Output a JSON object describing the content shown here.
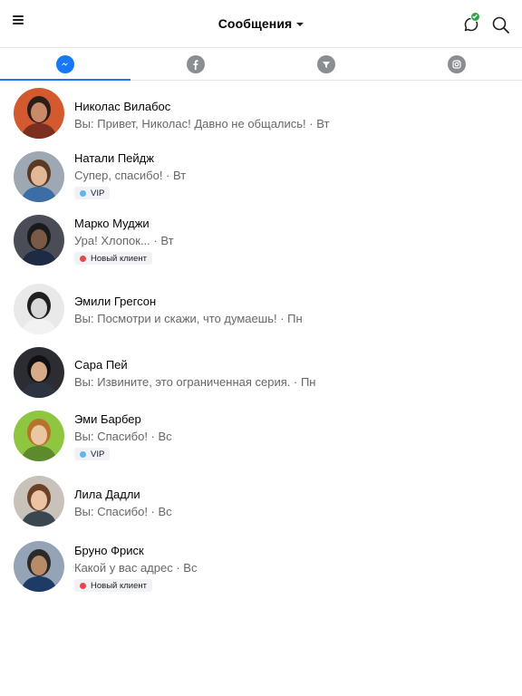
{
  "header": {
    "title": "Сообщения",
    "menu_icon": "hamburger-menu-icon",
    "status_icon": "chat-status-check-icon",
    "search_icon": "search-icon"
  },
  "tabs": [
    {
      "name": "messenger",
      "icon": "messenger-icon",
      "active": true
    },
    {
      "name": "facebook",
      "icon": "facebook-icon",
      "active": false
    },
    {
      "name": "filter",
      "icon": "filter-icon",
      "active": false
    },
    {
      "name": "instagram",
      "icon": "instagram-icon",
      "active": false
    }
  ],
  "colors": {
    "accent": "#1877f2",
    "online": "#31a24c",
    "vip_dot": "#5db7ec",
    "new_client_dot": "#e4474d",
    "secondary_text": "#65676b"
  },
  "conversations": [
    {
      "name": "Николас Вилабос",
      "preview": "Вы: Привет, Николас! Давно не общались! · Вт",
      "label": null
    },
    {
      "name": "Натали Пейдж",
      "preview": "Супер, спасибо! · Вт",
      "label": {
        "text": "VIP",
        "color": "#5db7ec"
      }
    },
    {
      "name": "Марко Муджи",
      "preview": "Ура! Хлопок... · Вт",
      "label": {
        "text": "Новый клиент",
        "color": "#e4474d"
      }
    },
    {
      "name": "Эмили Грегсон",
      "preview": "Вы: Посмотри и скажи, что думаешь! · Пн",
      "label": null
    },
    {
      "name": "Сара Пей",
      "preview": "Вы: Извините, это ограниченная серия. · Пн",
      "label": null
    },
    {
      "name": "Эми Барбер",
      "preview": "Вы: Спасибо! · Вс",
      "label": {
        "text": "VIP",
        "color": "#5db7ec"
      }
    },
    {
      "name": "Лила Дадли",
      "preview": "Вы: Спасибо! · Вс",
      "label": null
    },
    {
      "name": "Бруно Фриск",
      "preview": "Какой у вас адрес · Вс",
      "label": {
        "text": "Новый клиент",
        "color": "#e4474d"
      }
    }
  ]
}
